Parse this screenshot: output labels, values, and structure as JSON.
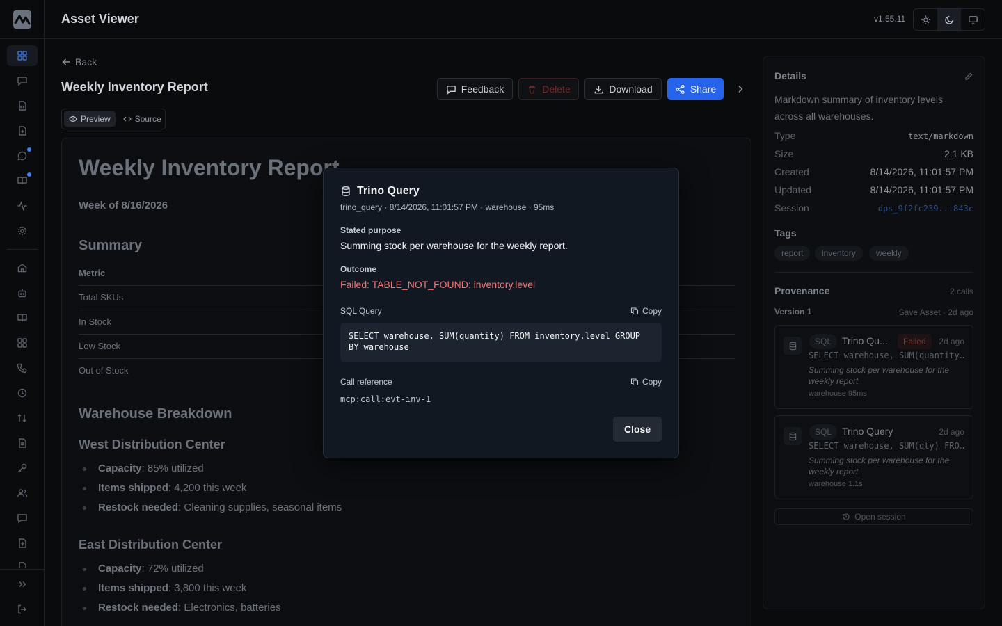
{
  "app": {
    "title": "Asset Viewer",
    "version": "v1.55.11"
  },
  "rail": {
    "icons": [
      "grid-icon",
      "message-icon",
      "file-code-icon",
      "file-plus-icon",
      "chat-bubble-icon",
      "book-open-icon",
      "activity-icon",
      "gear-icon",
      "home-icon",
      "bot-icon",
      "book-icon",
      "grid-icon",
      "phone-icon",
      "clock-icon",
      "sort-icon",
      "file-text-icon",
      "key-icon",
      "users-icon",
      "message-icon",
      "file-upload-icon",
      "file-icon"
    ],
    "footer_icons": [
      "expand-icon",
      "logout-icon"
    ]
  },
  "header": {
    "theme_options": [
      "light",
      "dark",
      "system"
    ],
    "active_theme": "dark"
  },
  "page": {
    "back_label": "Back",
    "title": "Weekly Inventory Report",
    "actions": {
      "feedback": "Feedback",
      "delete": "Delete",
      "download": "Download",
      "share": "Share"
    },
    "view_toggle": {
      "preview": "Preview",
      "source": "Source"
    }
  },
  "document": {
    "h1": "Weekly Inventory Report",
    "subtitle": "Week of 8/16/2026",
    "summary_heading": "Summary",
    "table_header": "Metric",
    "rows": [
      "Total SKUs",
      "In Stock",
      "Low Stock",
      "Out of Stock"
    ],
    "breakdown_heading": "Warehouse Breakdown",
    "west": {
      "heading": "West Distribution Center",
      "items": [
        {
          "k": "Capacity",
          "v": ": 85% utilized"
        },
        {
          "k": "Items shipped",
          "v": ": 4,200 this week"
        },
        {
          "k": "Restock needed",
          "v": ": Cleaning supplies, seasonal items"
        }
      ]
    },
    "east": {
      "heading": "East Distribution Center",
      "items": [
        {
          "k": "Capacity",
          "v": ": 72% utilized"
        },
        {
          "k": "Items shipped",
          "v": ": 3,800 this week"
        },
        {
          "k": "Restock needed",
          "v": ": Electronics, batteries"
        }
      ]
    }
  },
  "details": {
    "title": "Details",
    "description": "Markdown summary of inventory levels across all warehouses.",
    "fields": {
      "type_label": "Type",
      "type": "text/markdown",
      "size_label": "Size",
      "size": "2.1 KB",
      "created_label": "Created",
      "created": "8/14/2026, 11:01:57 PM",
      "updated_label": "Updated",
      "updated": "8/14/2026, 11:01:57 PM",
      "session_label": "Session",
      "session": "dps_9f2fc239...843c"
    },
    "tags_title": "Tags",
    "tags": [
      "report",
      "inventory",
      "weekly"
    ],
    "provenance_title": "Provenance",
    "provenance_count": "2 calls",
    "version_label": "Version 1",
    "version_meta": "Save Asset · 2d ago",
    "calls": [
      {
        "badge": "SQL",
        "name": "Trino Qu...",
        "status": "Failed",
        "ago": "2d ago",
        "query": "SELECT warehouse, SUM(quantity…",
        "purpose": "Summing stock per warehouse for the weekly report.",
        "meta": "warehouse  95ms"
      },
      {
        "badge": "SQL",
        "name": "Trino Query",
        "ago": "2d ago",
        "query": "SELECT warehouse, SUM(qty) FRO…",
        "purpose": "Summing stock per warehouse for the weekly report.",
        "meta": "warehouse  1.1s"
      }
    ],
    "open_session": "Open session"
  },
  "modal": {
    "title": "Trino Query",
    "meta": "trino_query · 8/14/2026, 11:01:57 PM · warehouse · 95ms",
    "purpose_label": "Stated purpose",
    "purpose": "Summing stock per warehouse for the weekly report.",
    "outcome_label": "Outcome",
    "outcome": "Failed: TABLE_NOT_FOUND: inventory.level",
    "sql_label": "SQL Query",
    "copy_label": "Copy",
    "sql_line1": "SELECT warehouse, SUM(quantity) FROM inventory.level GROUP",
    "sql_line2": "BY warehouse",
    "ref_label": "Call reference",
    "ref": "mcp:call:evt-inv-1",
    "close_label": "Close"
  }
}
